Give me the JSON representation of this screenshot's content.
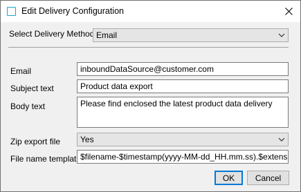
{
  "window": {
    "title": "Edit Delivery Configuration",
    "icon": "window-square-icon",
    "accent_color": "#1aa5c4"
  },
  "delivery_method": {
    "label": "Select Delivery Method",
    "value": "Email"
  },
  "form": {
    "email_label": "Email",
    "email_value": "inboundDataSource@customer.com",
    "subject_label": "Subject text",
    "subject_value": "Product data export",
    "body_label": "Body text",
    "body_value": "Please find enclosed the latest product data delivery",
    "zip_label": "Zip export file",
    "zip_value": "Yes",
    "filename_label": "File name template",
    "filename_value": "$filename-$timestamp(yyyy-MM-dd_HH.mm.ss).$extension"
  },
  "buttons": {
    "ok_label": "OK",
    "cancel_label": "Cancel"
  }
}
